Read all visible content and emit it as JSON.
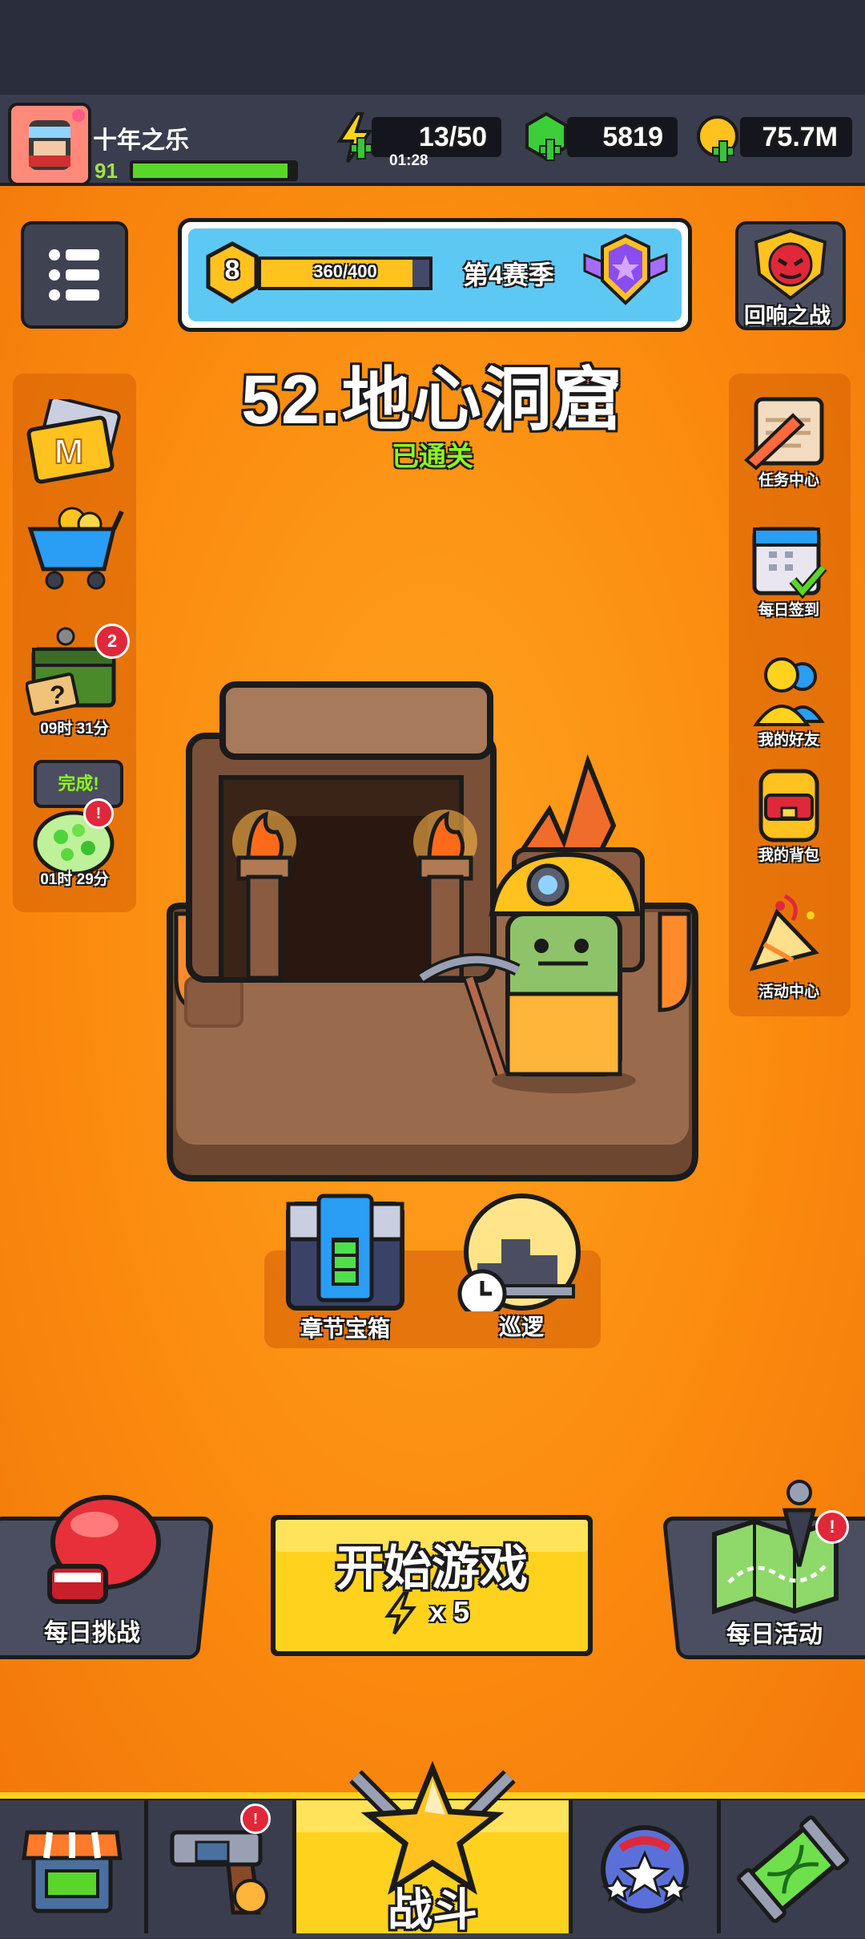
{
  "player": {
    "name": "十年之乐",
    "level": "91",
    "xp_fraction": 0.92
  },
  "resources": {
    "energy": {
      "value": "13/50",
      "timer": "01:28"
    },
    "gems": "5819",
    "coins": "75.7M"
  },
  "season": {
    "level": "8",
    "progress": "360/400",
    "progress_fraction": 0.9,
    "label": "第4赛季"
  },
  "echo_battle_label": "回响之战",
  "stage": {
    "title": "52.地心洞窟",
    "status": "已通关"
  },
  "left_panel": {
    "mystery_box_timer": "09时 31分",
    "mystery_box_badge": "2",
    "complete_bubble": "完成!",
    "egg_timer": "01时 29分"
  },
  "right_panel": {
    "tasks": "任务中心",
    "checkin": "每日签到",
    "friends": "我的好友",
    "backpack": "我的背包",
    "events": "活动中心"
  },
  "chapter_chest_label": "章节宝箱",
  "patrol_label": "巡逻",
  "daily_challenge_label": "每日挑战",
  "start_game": {
    "label": "开始游戏",
    "cost": "x 5"
  },
  "daily_event_label": "每日活动",
  "nav": {
    "battle_label": "战斗"
  },
  "colors": {
    "accent_yellow": "#ffd21e",
    "orange_bg": "#fb8c0f",
    "dark_panel": "#3a3d4d",
    "green_bar": "#5ad52a",
    "complete_green": "#8cf51c"
  }
}
